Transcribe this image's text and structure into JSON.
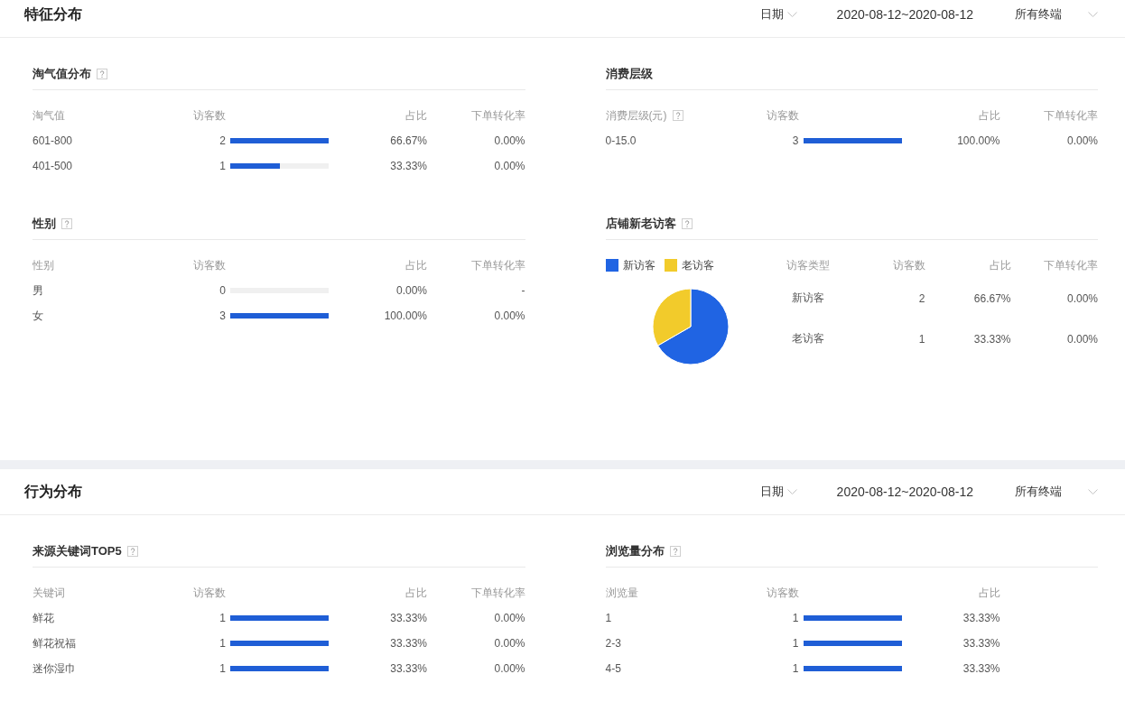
{
  "sections": [
    {
      "title": "特征分布",
      "filters": {
        "date_mode": "日期",
        "date_range": "2020-08-12~2020-08-12",
        "terminal": "所有终端"
      },
      "panels": [
        {
          "kind": "bars",
          "title": "淘气值分布",
          "help": true,
          "columns": [
            {
              "label": "淘气值",
              "help": false
            },
            {
              "label": "访客数",
              "help": false
            },
            {
              "label": "占比",
              "help": false
            },
            {
              "label": "下单转化率",
              "help": false
            }
          ],
          "rows": [
            {
              "name": "601-800",
              "visitors": "2",
              "level": 1,
              "share": "66.67%",
              "rate": "0.00%"
            },
            {
              "name": "401-500",
              "visitors": "1",
              "level": 0.5,
              "share": "33.33%",
              "rate": "0.00%"
            }
          ]
        },
        {
          "kind": "bars",
          "title": "消费层级",
          "help": false,
          "columns": [
            {
              "label": "消费层级(元)",
              "help": true
            },
            {
              "label": "访客数",
              "help": false
            },
            {
              "label": "占比",
              "help": false
            },
            {
              "label": "下单转化率",
              "help": false
            }
          ],
          "rows": [
            {
              "name": "0-15.0",
              "visitors": "3",
              "level": 1,
              "share": "100.00%",
              "rate": "0.00%"
            }
          ]
        },
        {
          "kind": "bars",
          "title": "性别",
          "help": true,
          "columns": [
            {
              "label": "性别",
              "help": false
            },
            {
              "label": "访客数",
              "help": false
            },
            {
              "label": "占比",
              "help": false
            },
            {
              "label": "下单转化率",
              "help": false
            }
          ],
          "rows": [
            {
              "name": "男",
              "visitors": "0",
              "level": 0,
              "share": "0.00%",
              "rate": "-"
            },
            {
              "name": "女",
              "visitors": "3",
              "level": 1,
              "share": "100.00%",
              "rate": "0.00%"
            }
          ]
        },
        {
          "kind": "pie",
          "title": "店铺新老访客",
          "help": true,
          "legend": [
            {
              "label": "新访客",
              "color": "#2064e3"
            },
            {
              "label": "老访客",
              "color": "#f2cb2b"
            }
          ],
          "chart_data": {
            "type": "pie",
            "values": [
              66.67,
              33.33
            ]
          },
          "columns": [
            {
              "label": "访客类型",
              "help": false
            },
            {
              "label": "访客数",
              "help": false
            },
            {
              "label": "占比",
              "help": false
            },
            {
              "label": "下单转化率",
              "help": false
            }
          ],
          "rows": [
            {
              "name": "新访客",
              "visitors": "2",
              "share": "66.67%",
              "rate": "0.00%"
            },
            {
              "name": "老访客",
              "visitors": "1",
              "share": "33.33%",
              "rate": "0.00%"
            }
          ]
        }
      ]
    },
    {
      "title": "行为分布",
      "filters": {
        "date_mode": "日期",
        "date_range": "2020-08-12~2020-08-12",
        "terminal": "所有终端"
      },
      "panels": [
        {
          "kind": "bars",
          "title": "来源关键词TOP5",
          "help": true,
          "columns": [
            {
              "label": "关键词",
              "help": false
            },
            {
              "label": "访客数",
              "help": false
            },
            {
              "label": "占比",
              "help": false
            },
            {
              "label": "下单转化率",
              "help": false
            }
          ],
          "rows": [
            {
              "name": "鲜花",
              "visitors": "1",
              "level": 1,
              "share": "33.33%",
              "rate": "0.00%"
            },
            {
              "name": "鲜花祝福",
              "visitors": "1",
              "level": 1,
              "share": "33.33%",
              "rate": "0.00%"
            },
            {
              "name": "迷你湿巾",
              "visitors": "1",
              "level": 1,
              "share": "33.33%",
              "rate": "0.00%"
            }
          ]
        },
        {
          "kind": "bars",
          "title": "浏览量分布",
          "help": true,
          "columns": [
            {
              "label": "浏览量",
              "help": false
            },
            {
              "label": "访客数",
              "help": false
            },
            {
              "label": "占比",
              "help": false
            }
          ],
          "rows": [
            {
              "name": "1",
              "visitors": "1",
              "level": 1,
              "share": "33.33%"
            },
            {
              "name": "2-3",
              "visitors": "1",
              "level": 1,
              "share": "33.33%"
            },
            {
              "name": "4-5",
              "visitors": "1",
              "level": 1,
              "share": "33.33%"
            }
          ]
        }
      ]
    }
  ]
}
